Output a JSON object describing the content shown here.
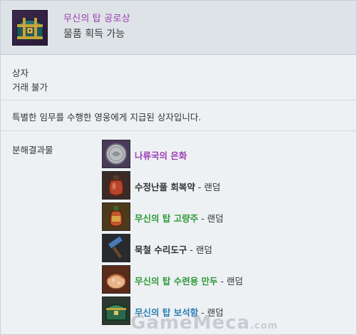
{
  "item": {
    "name": "무신의 탑 공로상",
    "subtitle": "물품 획득 가능",
    "category": "상자",
    "trade": "거래 불가",
    "description": "특별한 임무를 수행한 영웅에게 지급된 상자입니다."
  },
  "rewards_section": {
    "label": "분해결과물",
    "items": [
      {
        "name": "나류국의 은화",
        "suffix": "",
        "icon": "silver-coin-icon",
        "color": "#9b3fb5"
      },
      {
        "name": "수정난풀 회복약",
        "suffix": " - 랜덤",
        "icon": "recovery-potion-icon",
        "color": "#333333"
      },
      {
        "name": "무신의 탑 고량주",
        "suffix": " - 랜덤",
        "icon": "liquor-bottle-icon",
        "color": "#2f9a3c"
      },
      {
        "name": "묵철 수리도구",
        "suffix": " - 랜덤",
        "icon": "repair-hammer-icon",
        "color": "#333333"
      },
      {
        "name": "무신의 탑 수련용 만두",
        "suffix": " - 랜덤",
        "icon": "dumpling-icon",
        "color": "#2f9a3c"
      },
      {
        "name": "무신의 탑 보석함",
        "suffix": " - 랜덤",
        "icon": "jewel-box-icon",
        "color": "#2d7fb5"
      }
    ]
  },
  "watermark": {
    "main": "GameMeca",
    "domain": ".com"
  },
  "colors": {
    "title": "#9b3fb5",
    "header_bg": "#dde3e7",
    "body_bg": "#eef1f3"
  }
}
